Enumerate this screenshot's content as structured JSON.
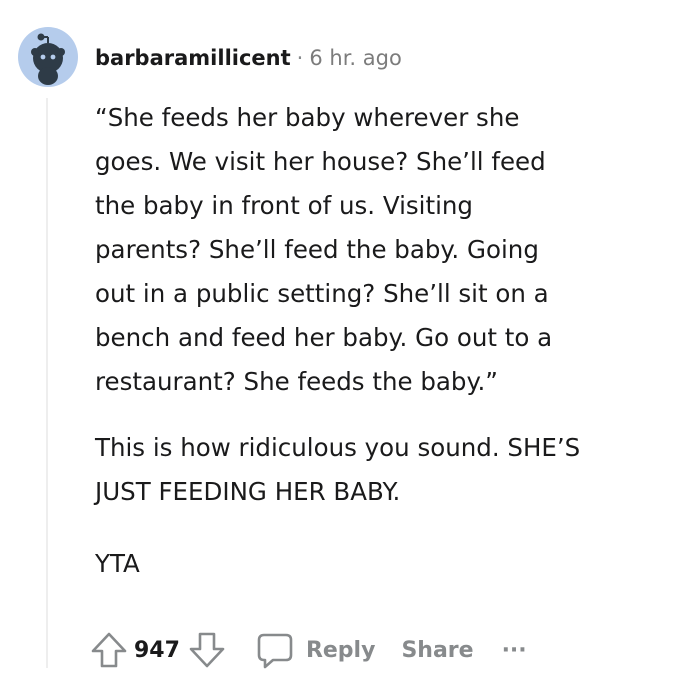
{
  "comment": {
    "author": "barbaramillicent",
    "separator": "·",
    "timestamp": "6 hr. ago",
    "paragraphs": [
      "“She feeds her baby wherever she\ngoes. We visit her house? She’ll feed\nthe baby in front of us. Visiting\nparents? She’ll feed the baby. Going\nout in a public setting? She’ll sit on a\nbench and feed her baby. Go out to a\nrestaurant? She feeds the baby.”",
      "This is how ridiculous you sound. SHE’S\nJUST FEEDING HER BABY.",
      "YTA"
    ]
  },
  "actions": {
    "score": "947",
    "reply_label": "Reply",
    "share_label": "Share",
    "more_label": "···"
  },
  "icons": {
    "avatar": "snoo-avatar-icon",
    "upvote": "upvote-arrow-icon",
    "downvote": "downvote-arrow-icon",
    "reply": "comment-bubble-icon",
    "more": "more-dots-icon"
  },
  "colors": {
    "avatar_bg": "#b5ccec",
    "snoo": "#2e3b47",
    "muted": "#878a8c",
    "text": "#1a1a1b"
  }
}
